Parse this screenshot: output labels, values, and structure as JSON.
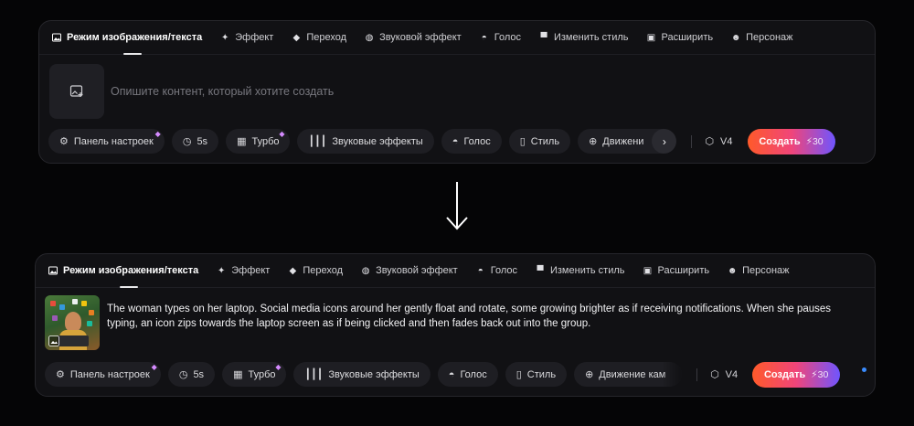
{
  "tabs": [
    {
      "label": "Режим изображения/текста",
      "icon": "image-icon",
      "active": true
    },
    {
      "label": "Эффект",
      "icon": "sparkle-icon"
    },
    {
      "label": "Переход",
      "icon": "transition-icon"
    },
    {
      "label": "Звуковой эффект",
      "icon": "sound-effect-icon"
    },
    {
      "label": "Голос",
      "icon": "lips-icon"
    },
    {
      "label": "Изменить стиль",
      "icon": "paint-roller-icon"
    },
    {
      "label": "Расширить",
      "icon": "expand-icon"
    },
    {
      "label": "Персонаж",
      "icon": "face-icon"
    }
  ],
  "before": {
    "placeholder": "Опишите контент, который хотите создать"
  },
  "after": {
    "prompt": "The woman types on her laptop. Social media icons around her gently float and rotate, some growing brighter as if receiving notifications. When she pauses typing, an icon zips towards the laptop screen as if being clicked and then fades back out into the group."
  },
  "toolbar": {
    "settings": "Панель настроек",
    "duration": "5s",
    "turbo": "Турбо",
    "sound_effects": "Звуковые эффекты",
    "voice": "Голос",
    "style": "Стиль",
    "motion_truncated": "Движени",
    "motion_truncated_2": "Движение кам",
    "version": "V4",
    "create": "Создать",
    "cost": "⚡30"
  },
  "colors": {
    "accent_start": "#ff5a2a",
    "accent_mid": "#f0457a",
    "accent_end": "#6f55ff",
    "premium_gem": "#d58bff"
  }
}
